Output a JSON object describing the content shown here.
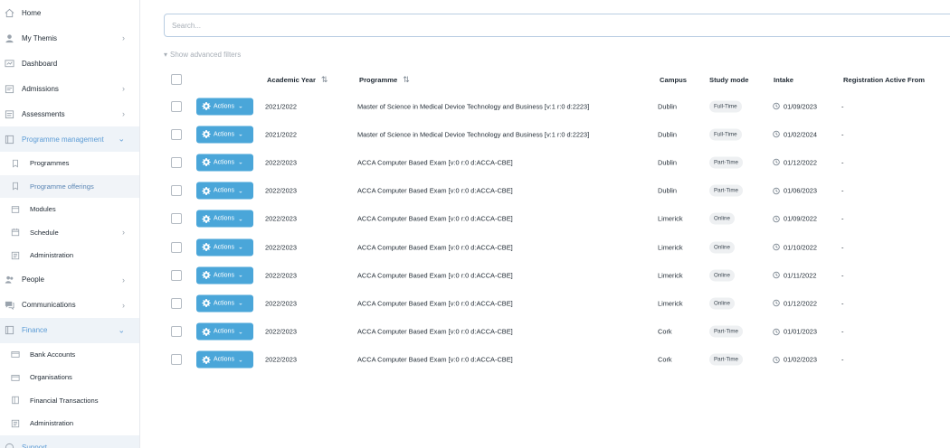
{
  "sidebar": {
    "items": [
      {
        "label": "Home",
        "icon": "home-icon",
        "level": "top",
        "chevron": "",
        "state": ""
      },
      {
        "label": "My Themis",
        "icon": "user-icon",
        "level": "top",
        "chevron": "›",
        "state": ""
      },
      {
        "label": "Dashboard",
        "icon": "dashboard-icon",
        "level": "top",
        "chevron": "",
        "state": ""
      },
      {
        "label": "Admissions",
        "icon": "admissions-icon",
        "level": "top",
        "chevron": "›",
        "state": ""
      },
      {
        "label": "Assessments",
        "icon": "assessments-icon",
        "level": "top",
        "chevron": "›",
        "state": ""
      },
      {
        "label": "Programme management",
        "icon": "programme-management-icon",
        "level": "top",
        "chevron": "⌄",
        "state": "open"
      },
      {
        "label": "Programmes",
        "icon": "programmes-icon",
        "level": "sub",
        "chevron": "",
        "state": ""
      },
      {
        "label": "Programme offerings",
        "icon": "programme-offerings-icon",
        "level": "sub",
        "chevron": "",
        "state": "selected"
      },
      {
        "label": "Modules",
        "icon": "modules-icon",
        "level": "sub",
        "chevron": "",
        "state": ""
      },
      {
        "label": "Schedule",
        "icon": "calendar-icon",
        "level": "sub",
        "chevron": "›",
        "state": ""
      },
      {
        "label": "Administration",
        "icon": "administration-icon",
        "level": "sub",
        "chevron": "",
        "state": ""
      },
      {
        "label": "People",
        "icon": "people-icon",
        "level": "top",
        "chevron": "›",
        "state": ""
      },
      {
        "label": "Communications",
        "icon": "chat-icon",
        "level": "top",
        "chevron": "›",
        "state": ""
      },
      {
        "label": "Finance",
        "icon": "finance-icon",
        "level": "top",
        "chevron": "⌄",
        "state": "open"
      },
      {
        "label": "Bank Accounts",
        "icon": "bank-icon",
        "level": "sub",
        "chevron": "",
        "state": ""
      },
      {
        "label": "Organisations",
        "icon": "organisations-icon",
        "level": "sub",
        "chevron": "",
        "state": ""
      },
      {
        "label": "Financial Transactions",
        "icon": "transactions-icon",
        "level": "sub",
        "chevron": "",
        "state": ""
      },
      {
        "label": "Administration",
        "icon": "administration-icon",
        "level": "sub",
        "chevron": "",
        "state": ""
      },
      {
        "label": "Support",
        "icon": "support-icon",
        "level": "top",
        "chevron": "⌄",
        "state": "open"
      }
    ]
  },
  "search": {
    "placeholder": "Search...",
    "value": ""
  },
  "filters": {
    "advanced_label": "Show advanced filters"
  },
  "table": {
    "columns": {
      "academic_year": "Academic Year",
      "programme": "Programme",
      "campus": "Campus",
      "study_mode": "Study mode",
      "intake": "Intake",
      "registration": "Registration Active From"
    },
    "actions_label": "Actions",
    "rows": [
      {
        "year": "2021/2022",
        "programme": "Master of Science in Medical Device Technology and Business [v:1 r:0 d:2223]",
        "campus": "Dublin",
        "mode": "Full-Time",
        "intake": "01/09/2023",
        "reg": "-"
      },
      {
        "year": "2021/2022",
        "programme": "Master of Science in Medical Device Technology and Business [v:1 r:0 d:2223]",
        "campus": "Dublin",
        "mode": "Full-Time",
        "intake": "01/02/2024",
        "reg": "-"
      },
      {
        "year": "2022/2023",
        "programme": "ACCA Computer Based Exam [v:0 r:0 d:ACCA-CBE]",
        "campus": "Dublin",
        "mode": "Part-Time",
        "intake": "01/12/2022",
        "reg": "-"
      },
      {
        "year": "2022/2023",
        "programme": "ACCA Computer Based Exam [v:0 r:0 d:ACCA-CBE]",
        "campus": "Dublin",
        "mode": "Part-Time",
        "intake": "01/06/2023",
        "reg": "-"
      },
      {
        "year": "2022/2023",
        "programme": "ACCA Computer Based Exam [v:0 r:0 d:ACCA-CBE]",
        "campus": "Limerick",
        "mode": "Online",
        "intake": "01/09/2022",
        "reg": "-"
      },
      {
        "year": "2022/2023",
        "programme": "ACCA Computer Based Exam [v:0 r:0 d:ACCA-CBE]",
        "campus": "Limerick",
        "mode": "Online",
        "intake": "01/10/2022",
        "reg": "-"
      },
      {
        "year": "2022/2023",
        "programme": "ACCA Computer Based Exam [v:0 r:0 d:ACCA-CBE]",
        "campus": "Limerick",
        "mode": "Online",
        "intake": "01/11/2022",
        "reg": "-"
      },
      {
        "year": "2022/2023",
        "programme": "ACCA Computer Based Exam [v:0 r:0 d:ACCA-CBE]",
        "campus": "Limerick",
        "mode": "Online",
        "intake": "01/12/2022",
        "reg": "-"
      },
      {
        "year": "2022/2023",
        "programme": "ACCA Computer Based Exam [v:0 r:0 d:ACCA-CBE]",
        "campus": "Cork",
        "mode": "Part-Time",
        "intake": "01/01/2023",
        "reg": "-"
      },
      {
        "year": "2022/2023",
        "programme": "ACCA Computer Based Exam [v:0 r:0 d:ACCA-CBE]",
        "campus": "Cork",
        "mode": "Part-Time",
        "intake": "01/02/2023",
        "reg": "-"
      }
    ]
  },
  "colors": {
    "accent": "#4aa6d9",
    "active_text": "#5b9bd5",
    "sidebar_active_bg": "#eef3f8"
  }
}
